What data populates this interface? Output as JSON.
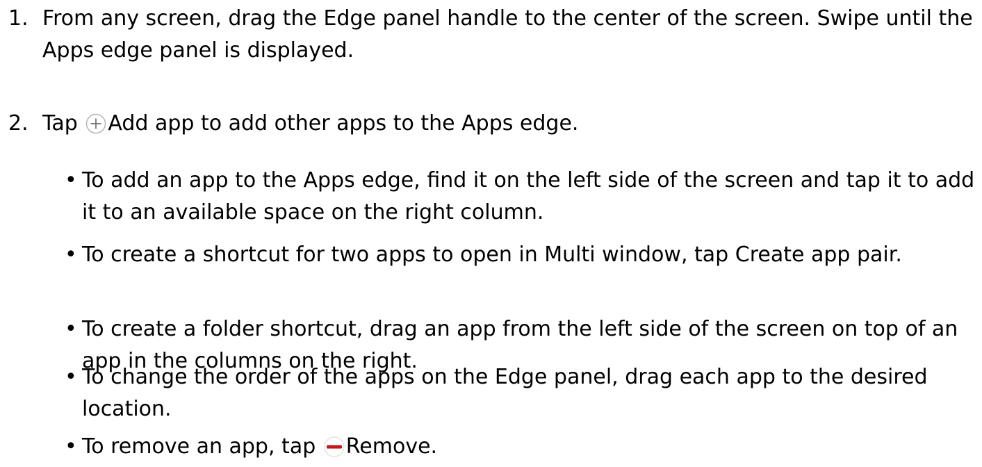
{
  "steps": [
    {
      "number": "1.",
      "text_1": "From any screen, drag the ",
      "bold_1": "Edge panel handle",
      "text_2": " to the center of the screen. Swipe until the Apps edge panel is displayed."
    },
    {
      "number": "2.",
      "text_1": "Tap ",
      "icon": "plus-circle-icon",
      "bold_1": "Add app",
      "text_2": " to add other apps to the Apps edge."
    }
  ],
  "bullets": [
    {
      "text_1": "To add an app to the Apps edge, find it on the left side of the screen and tap it to add it to an available space on the right column."
    },
    {
      "text_1": "To create a shortcut for two apps to open in Multi window, tap ",
      "bold_1": "Create app pair",
      "text_2": "."
    },
    {
      "text_1": "To create a folder shortcut, drag an app from the left side of the screen on top of an app in the columns on the right."
    },
    {
      "text_1": "To change the order of the apps on the Edge panel, drag each app to the desired location."
    },
    {
      "text_1": "To remove an app, tap ",
      "icon": "minus-circle-icon",
      "bold_1": "Remove",
      "text_2": "."
    }
  ],
  "bullet_char": "•",
  "colors": {
    "text": "#000000",
    "remove_icon": "#c4161c",
    "add_icon_stroke": "#b5b5b5"
  }
}
